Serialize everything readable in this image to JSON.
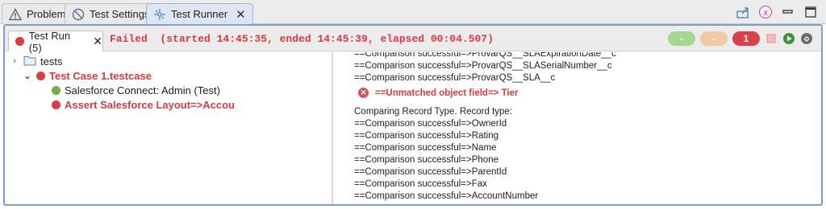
{
  "view_tabs": [
    {
      "label": "Problems",
      "icon": "warning-icon"
    },
    {
      "label": "Test Settings",
      "icon": "no-entry-icon"
    },
    {
      "label": "Test Runner",
      "icon": "runner-icon",
      "active": true
    }
  ],
  "view_toolbar": [
    "export-icon",
    "clear-icon",
    "minimize-icon",
    "maximize-icon"
  ],
  "run": {
    "tab_label": "Test Run (5)",
    "status": "Failed  (started 14:45:35, ended 14:45:39, elapsed 00:04.507)",
    "counters": {
      "passed": "-",
      "skipped": "-",
      "failed": "1"
    }
  },
  "tree": {
    "root": "tests",
    "test_case": "Test Case 1.testcase",
    "steps": [
      {
        "label": "Salesforce Connect: Admin (Test)",
        "status": "passed"
      },
      {
        "label": "Assert Salesforce Layout=>Accou",
        "status": "failed"
      }
    ]
  },
  "log": {
    "lines_top": [
      "==Comparison successful=>ProvarQS__SLAExpirationDate__c",
      "==Comparison successful=>ProvarQS__SLASerialNumber__c",
      "==Comparison successful=>ProvarQS__SLA__c"
    ],
    "error_line": "==Unmatched object field=> Tier",
    "section_header": "Comparing Record Type. Record type:",
    "lines_bottom": [
      "==Comparison successful=>OwnerId",
      "==Comparison successful=>Rating",
      "==Comparison successful=>Name",
      "==Comparison successful=>Phone",
      "==Comparison successful=>ParentId",
      "==Comparison successful=>Fax",
      "==Comparison successful=>AccountNumber"
    ]
  },
  "colors": {
    "error": "#e0393e",
    "pass": "#70b040",
    "accent": "#7f9dcc"
  }
}
